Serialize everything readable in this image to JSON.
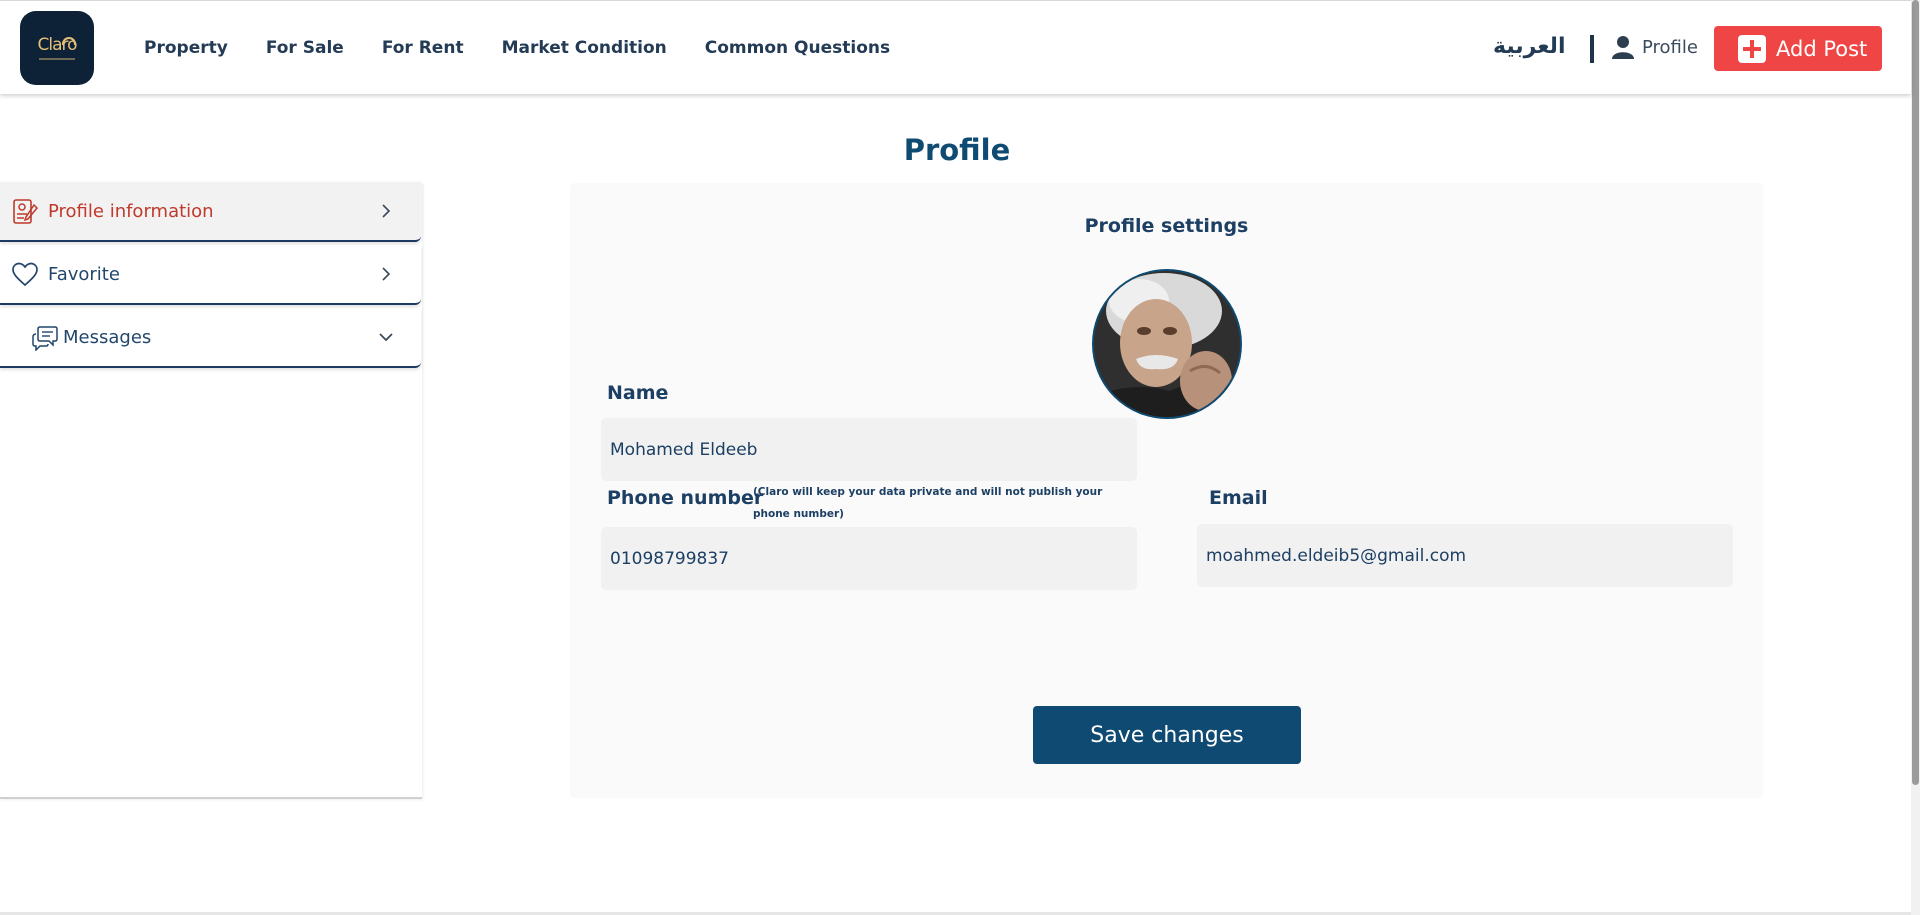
{
  "header": {
    "logo_text": "Claro",
    "nav": [
      "Property",
      "For Sale",
      "For Rent",
      "Market Condition",
      "Common Questions"
    ],
    "language": "العربية",
    "profile_label": "Profile",
    "add_post_label": "Add Post"
  },
  "sidebar": {
    "items": [
      {
        "label": "Profile information",
        "icon": "profile-document-icon",
        "chevron": "chevron-right-icon"
      },
      {
        "label": "Favorite",
        "icon": "heart-icon",
        "chevron": "chevron-right-icon"
      },
      {
        "label": "Messages",
        "icon": "chat-bubbles-icon",
        "chevron": "chevron-down-icon"
      }
    ]
  },
  "main": {
    "title": "Profile",
    "settings_title": "Profile settings",
    "name_label": "Name",
    "name_value": "Mohamed Eldeeb",
    "phone_label": "Phone number",
    "phone_note": "(Claro will keep your data private and will not publish your phone number)",
    "phone_value": "01098799837",
    "email_label": "Email",
    "email_value": "moahmed.eldeib5@gmail.com",
    "save_label": "Save changes"
  },
  "colors": {
    "primary": "#0f4a72",
    "accent": "#f04545",
    "active_item": "#c0392b",
    "logo_bg": "#0d2236"
  }
}
